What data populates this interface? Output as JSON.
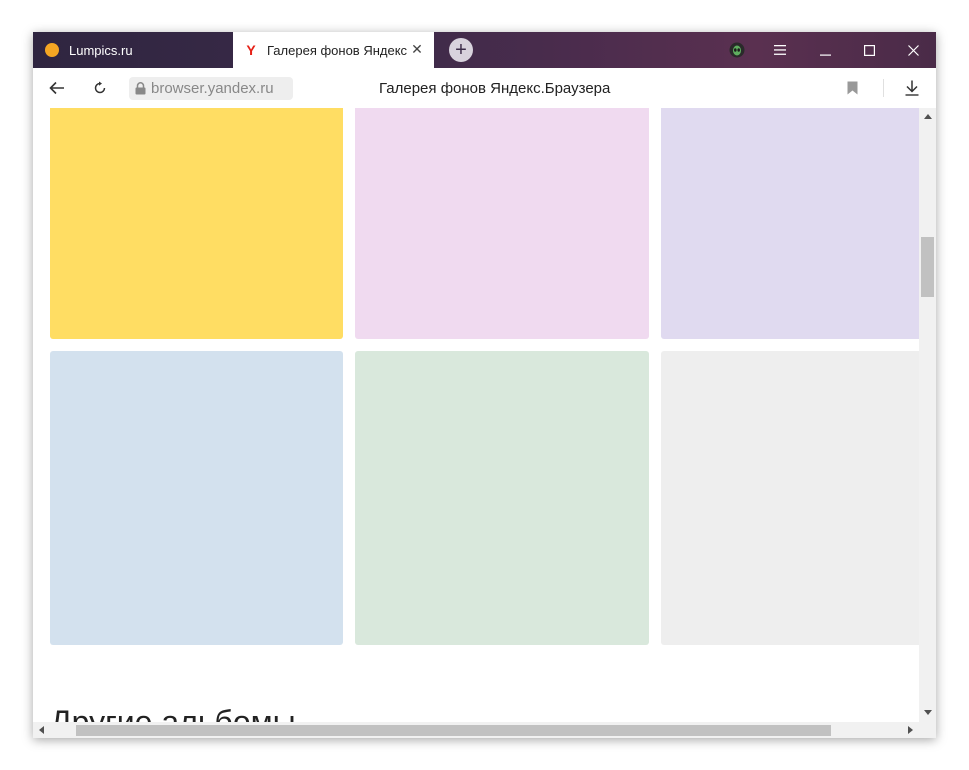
{
  "tabs": [
    {
      "label": "Lumpics.ru"
    },
    {
      "label": "Галерея фонов Яндекс.Браузера"
    }
  ],
  "address": {
    "url": "browser.yandex.ru",
    "title": "Галерея фонов Яндекс.Браузера"
  },
  "gallery": {
    "tiles": [
      {
        "color": "#ffdd63"
      },
      {
        "color": "#f0daf0"
      },
      {
        "color": "#e0daf0"
      },
      {
        "color": "#d3e1ee"
      },
      {
        "color": "#d9e8dc"
      },
      {
        "color": "#eeeeee"
      }
    ],
    "section_heading": "Другие альбомы"
  },
  "theme": {
    "titlebar": "#3a2a48",
    "accent": "#e62117"
  }
}
